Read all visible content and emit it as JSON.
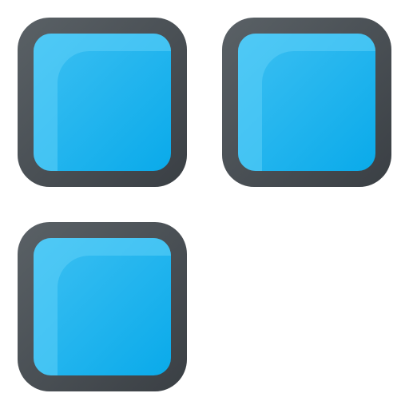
{
  "icon": {
    "name": "add-apps-icon",
    "tiles": [
      {
        "name": "app-tile-top-left"
      },
      {
        "name": "app-tile-top-right"
      },
      {
        "name": "app-tile-bottom-left"
      }
    ],
    "add_symbol": {
      "name": "plus-icon"
    }
  },
  "colors": {
    "frame_dark": "#3c4247",
    "frame_light": "#5a6166",
    "tile_fill": "#0fb0ee",
    "tile_fill_light": "#49c6f3",
    "tile_highlight": "#5fd0f7",
    "plus": "#6cb644",
    "plus_shadow": "#5ea23a"
  }
}
